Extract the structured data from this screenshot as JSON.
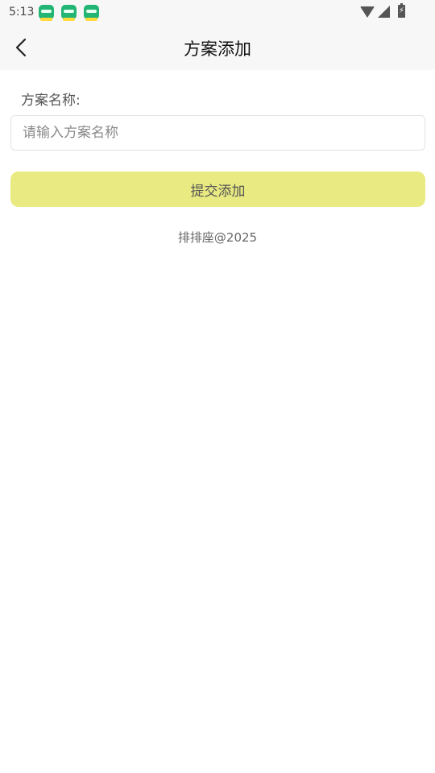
{
  "status_bar": {
    "time": "5:13",
    "notification_icons": [
      "app-notification-icon",
      "app-notification-icon",
      "app-notification-icon"
    ],
    "system_icons": [
      "wifi-icon",
      "signal-icon",
      "battery-charging-icon"
    ]
  },
  "nav": {
    "title": "方案添加",
    "back_icon": "chevron-left-icon"
  },
  "form": {
    "label": "方案名称:",
    "name_value": "",
    "name_placeholder": "请输入方案名称",
    "submit_label": "提交添加"
  },
  "footer": {
    "text": "排排座@2025"
  },
  "colors": {
    "submit_background": "#e9ea82",
    "nav_background": "#f7f7f7",
    "notification_icon": "#22b573"
  }
}
